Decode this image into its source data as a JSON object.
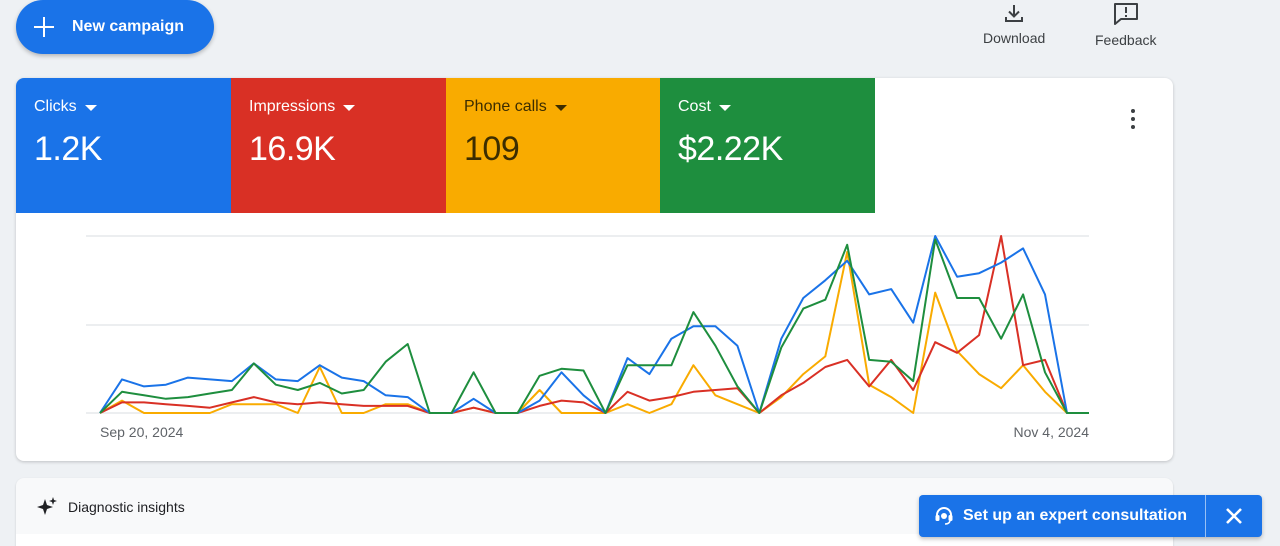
{
  "toolbar": {
    "new_campaign_label": "New campaign",
    "download_label": "Download",
    "feedback_label": "Feedback"
  },
  "tiles": [
    {
      "label": "Clicks",
      "value": "1.2K",
      "color": "#1a73e8"
    },
    {
      "label": "Impressions",
      "value": "16.9K",
      "color": "#d93025"
    },
    {
      "label": "Phone calls",
      "value": "109",
      "color": "#f9ab00"
    },
    {
      "label": "Cost",
      "value": "$2.22K",
      "color": "#1e8e3e"
    }
  ],
  "chart": {
    "start_date": "Sep 20, 2024",
    "end_date": "Nov 4, 2024"
  },
  "chart_data": {
    "type": "line",
    "x_range": [
      "Sep 20, 2024",
      "Nov 4, 2024"
    ],
    "y_scale": "each series normalized to its own max (0-1); no y tick labels shown",
    "grid": true,
    "series": [
      {
        "name": "Clicks",
        "color": "#1a73e8",
        "values": [
          0,
          0.19,
          0.15,
          0.16,
          0.2,
          0.19,
          0.18,
          0.28,
          0.19,
          0.18,
          0.27,
          0.2,
          0.18,
          0.1,
          0.09,
          0,
          0,
          0.08,
          0,
          0,
          0.07,
          0.23,
          0.1,
          0,
          0.31,
          0.22,
          0.42,
          0.49,
          0.49,
          0.38,
          0,
          0.42,
          0.65,
          0.75,
          0.86,
          0.67,
          0.7,
          0.51,
          1,
          0.77,
          0.79,
          0.85,
          0.93,
          0.67,
          0,
          0
        ]
      },
      {
        "name": "Impressions",
        "color": "#d93025",
        "values": [
          0,
          0.06,
          0.06,
          0.05,
          0.04,
          0.03,
          0.06,
          0.09,
          0.06,
          0.05,
          0.06,
          0.05,
          0.04,
          0.04,
          0.04,
          0,
          0,
          0.03,
          0,
          0,
          0.04,
          0.07,
          0.06,
          0,
          0.12,
          0.07,
          0.09,
          0.12,
          0.13,
          0.14,
          0,
          0.1,
          0.17,
          0.26,
          0.3,
          0.15,
          0.3,
          0.13,
          0.4,
          0.34,
          0.44,
          1,
          0.27,
          0.3,
          0,
          0
        ]
      },
      {
        "name": "Phone calls",
        "color": "#f9ab00",
        "values": [
          0,
          0.07,
          0,
          0,
          0,
          0,
          0.05,
          0.05,
          0.05,
          0,
          0.26,
          0,
          0,
          0.05,
          0.05,
          0,
          0,
          0.03,
          0,
          0,
          0.13,
          0,
          0,
          0,
          0.05,
          0,
          0.05,
          0.27,
          0.1,
          0.05,
          0,
          0.09,
          0.22,
          0.32,
          0.91,
          0.16,
          0.09,
          0,
          0.68,
          0.35,
          0.22,
          0.14,
          0.27,
          0.12,
          0,
          0
        ]
      },
      {
        "name": "Cost",
        "color": "#1e8e3e",
        "values": [
          0,
          0.12,
          0.1,
          0.08,
          0.09,
          0.11,
          0.13,
          0.28,
          0.16,
          0.13,
          0.17,
          0.11,
          0.13,
          0.29,
          0.39,
          0,
          0,
          0.23,
          0,
          0,
          0.21,
          0.25,
          0.24,
          0,
          0.27,
          0.27,
          0.27,
          0.57,
          0.38,
          0.15,
          0,
          0.37,
          0.59,
          0.64,
          0.95,
          0.3,
          0.29,
          0.18,
          0.98,
          0.65,
          0.65,
          0.42,
          0.67,
          0.23,
          0,
          0
        ]
      }
    ]
  },
  "diagnostics": {
    "label": "Diagnostic insights"
  },
  "consultation": {
    "label": "Set up an expert consultation"
  }
}
